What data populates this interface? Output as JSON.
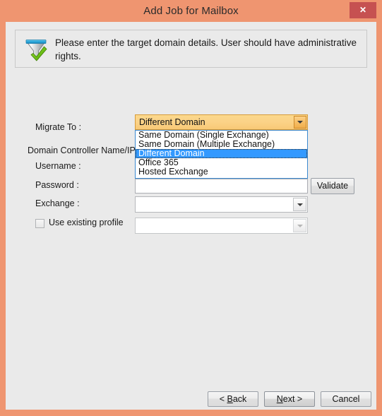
{
  "window": {
    "title": "Add Job for Mailbox",
    "close_label": "✕",
    "frame_color": "#ef9570",
    "titlebar_color": "#ef9570",
    "close_button_color": "#c65151",
    "client_background": "#eaeaea"
  },
  "banner": {
    "icon": "funnel-check-icon",
    "message": "Please enter the target domain details. User should have administrative rights."
  },
  "form": {
    "migrate_to": {
      "label": "Migrate To :",
      "value": "Different Domain",
      "expanded": true,
      "highlight_color": "#fbd287",
      "options": [
        "Same Domain (Single Exchange)",
        "Same Domain (Multiple Exchange)",
        "Different Domain",
        "Office 365",
        "Hosted Exchange"
      ],
      "selected_index": 2,
      "selection_color": "#3399ff"
    },
    "domain_controller": {
      "label": "Domain Controller Name/IP",
      "value": ""
    },
    "username": {
      "label": "Username :",
      "value": ""
    },
    "password": {
      "label": "Password :",
      "value": "",
      "placeholder": ""
    },
    "exchange": {
      "label": "Exchange :",
      "value": "",
      "enabled": true
    },
    "use_existing_profile": {
      "label": "Use existing profile",
      "checked": false
    },
    "profile_combo": {
      "value": "",
      "enabled": false
    },
    "validate_button": "Validate"
  },
  "footer": {
    "back": "< Back",
    "back_prefix": "< ",
    "back_mnemonic": "B",
    "back_suffix": "ack",
    "next_mnemonic": "N",
    "next_suffix": "ext >",
    "cancel": "Cancel"
  }
}
